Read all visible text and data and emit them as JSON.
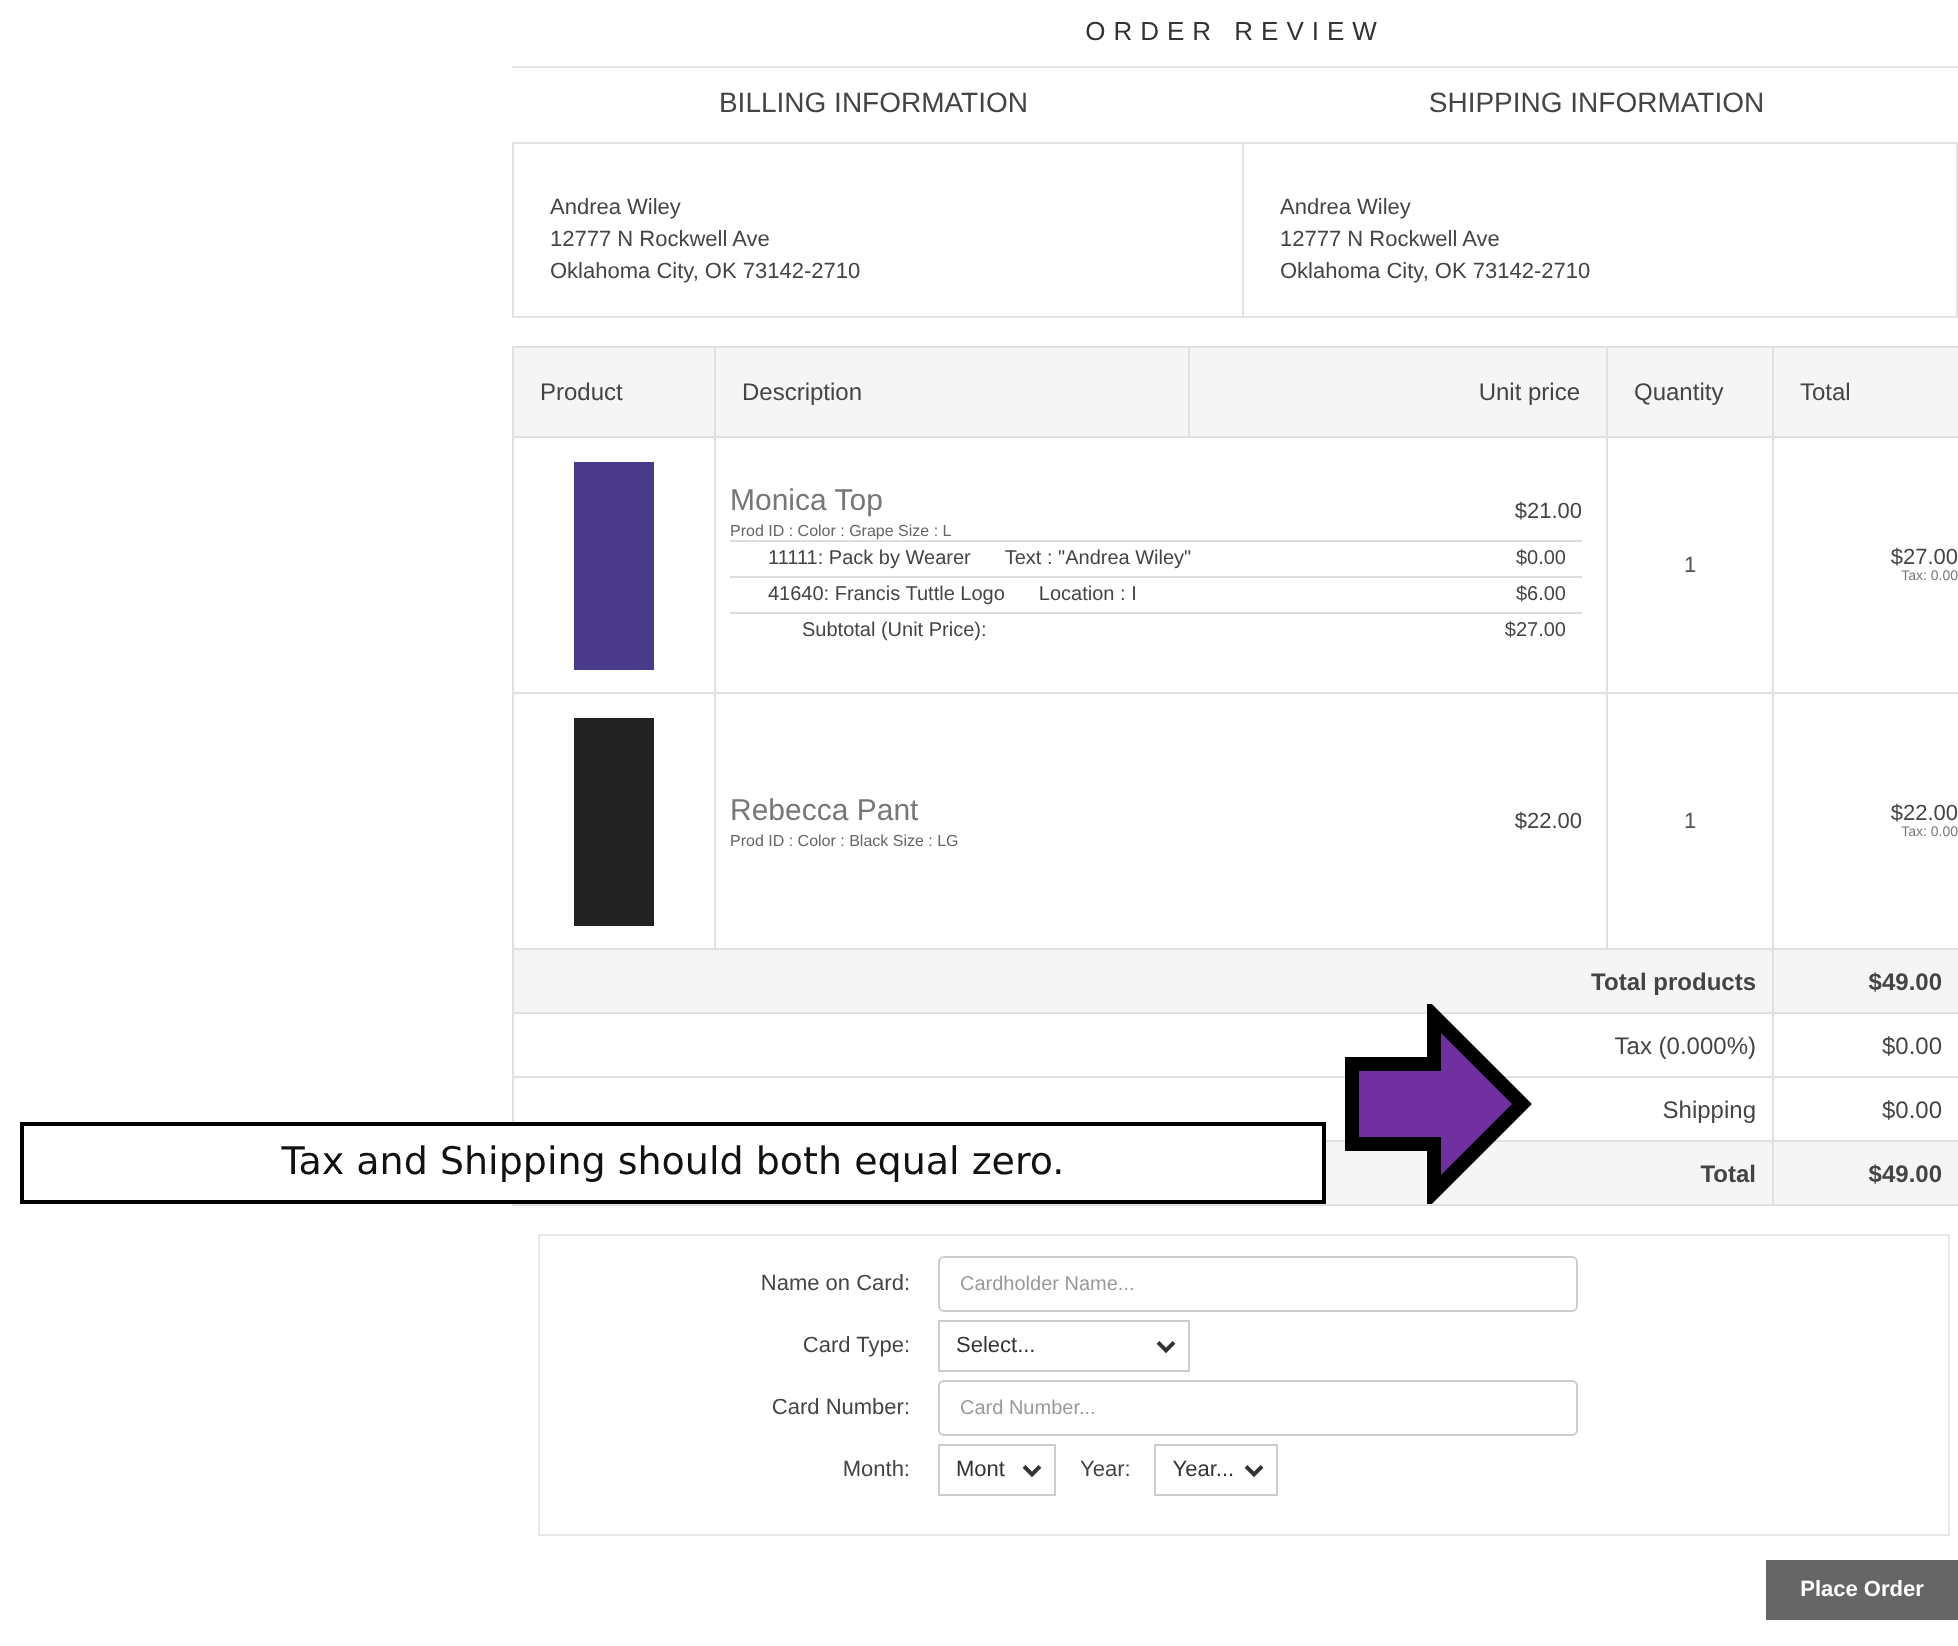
{
  "title": "ORDER REVIEW",
  "addresses": [
    {
      "heading": "BILLING INFORMATION",
      "lines": [
        "Andrea Wiley",
        "12777 N Rockwell Ave",
        "Oklahoma City, OK 73142-2710"
      ]
    },
    {
      "heading": "SHIPPING INFORMATION",
      "lines": [
        "Andrea Wiley",
        "12777 N Rockwell Ave",
        "Oklahoma City, OK 73142-2710"
      ]
    }
  ],
  "table": {
    "columns": [
      "Product",
      "Description",
      "Unit price",
      "Quantity",
      "Total"
    ],
    "rows": [
      {
        "name": "Monica Top",
        "details": "Prod ID : Color : Grape Size : L",
        "price": "$21.00",
        "options": [
          {
            "item": "11111: Pack by Wearer",
            "extra": "Text : \"Andrea Wiley\"",
            "price": "$0.00"
          },
          {
            "item": "41640: Francis Tuttle Logo",
            "extra": "Location : I",
            "price": "$6.00"
          }
        ],
        "subtotal_label": "Subtotal (Unit Price):",
        "subtotal": "$27.00",
        "quantity": "1",
        "total": "$27.00",
        "tax": "Tax: 0.00"
      },
      {
        "name": "Rebecca Pant",
        "details": "Prod ID : Color : Black Size : LG",
        "price": "$22.00",
        "quantity": "1",
        "total": "$22.00",
        "tax": "Tax: 0.00"
      }
    ],
    "summary": [
      {
        "kind": "emphasis",
        "label": "Total products",
        "value": "$49.00"
      },
      {
        "kind": "plain",
        "label": "Tax (0.000%)",
        "value": "$0.00"
      },
      {
        "kind": "plain",
        "label": "Shipping",
        "value": "$0.00"
      },
      {
        "kind": "emphasis",
        "label": "Total",
        "value": "$49.00"
      }
    ]
  },
  "payment_form": {
    "fields": [
      {
        "kind": "text",
        "label": "Name on Card:",
        "placeholder": "Cardholder Name..."
      },
      {
        "kind": "select",
        "label": "Card Type:",
        "value": "Select..."
      },
      {
        "kind": "text",
        "label": "Card Number:",
        "placeholder": "Card Number..."
      },
      {
        "kind": "date",
        "label": "Month:",
        "value": "Mont",
        "second_label": "Year:",
        "second_value": "Year..."
      }
    ]
  },
  "button": "Place Order",
  "callout": {
    "text": "Tax and Shipping should both equal zero."
  }
}
